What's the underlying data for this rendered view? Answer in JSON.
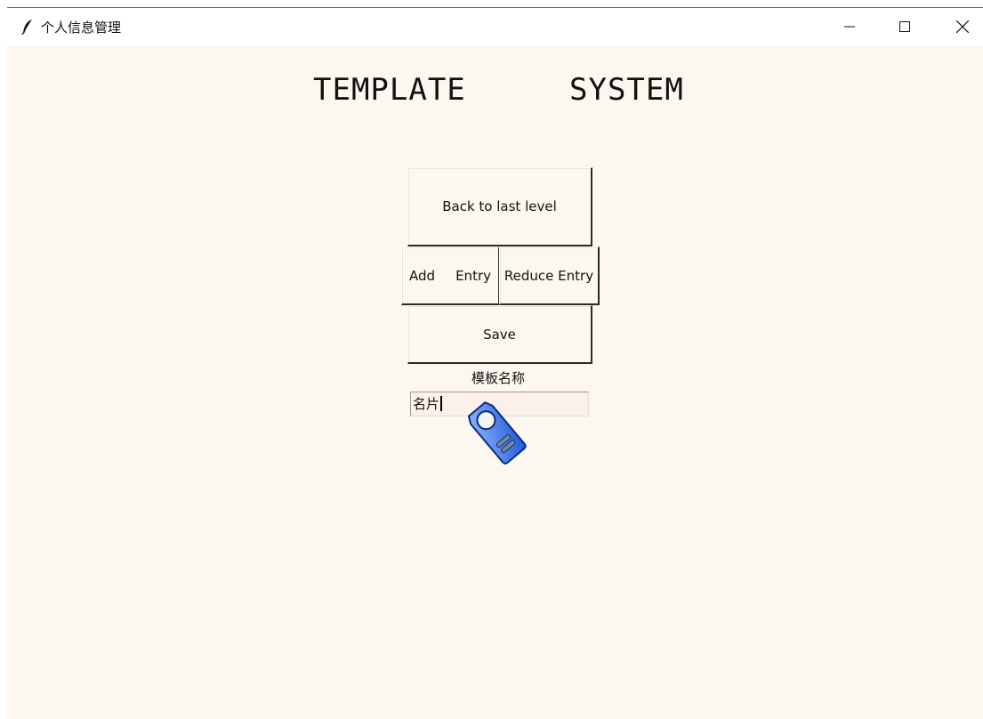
{
  "window": {
    "title": "个人信息管理",
    "controls": {
      "minimize": "–",
      "maximize": "□",
      "close": "×"
    },
    "background_color": "#fcf8ef",
    "accent_border_color": "#2b78c8"
  },
  "main": {
    "heading_left": "TEMPLATE",
    "heading_right": "SYSTEM",
    "buttons": {
      "back": "Back to last level",
      "add_part1": "Add",
      "add_part2": "Entry",
      "reduce": "Reduce Entry",
      "save": "Save"
    },
    "template_name": {
      "label": "模板名称",
      "value": "名片",
      "field_color": "#fcf0ea"
    }
  },
  "icons": {
    "app": "feather-icon",
    "cursor": "tag-pointer-icon"
  }
}
